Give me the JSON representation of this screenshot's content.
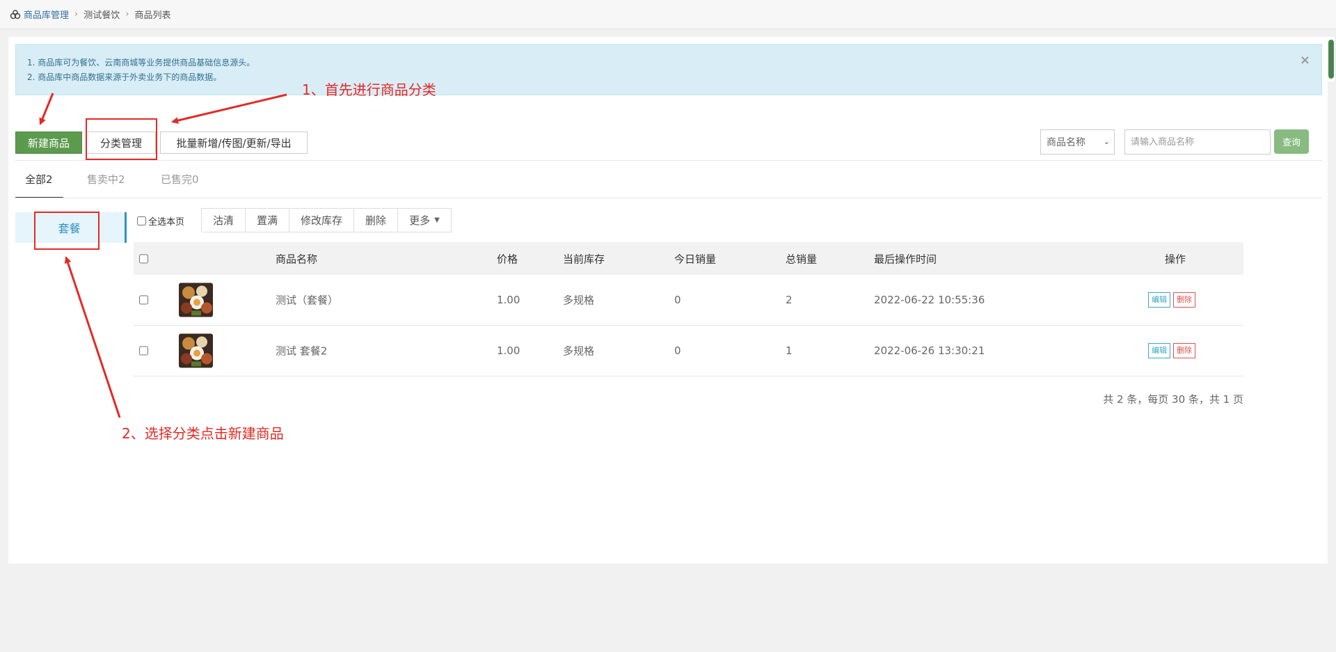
{
  "breadcrumb": {
    "items": [
      "商品库管理",
      "测试餐饮",
      "商品列表"
    ],
    "separator": "›"
  },
  "alert": {
    "lines": [
      "1. 商品库可为餐饮、云南商城等业务提供商品基础信息源头。",
      "2. 商品库中商品数据来源于外卖业务下的商品数据。"
    ],
    "close": "×"
  },
  "annotations": {
    "step1": "1、首先进行商品分类",
    "step2": "2、选择分类点击新建商品",
    "color": "#e32a24"
  },
  "actions": {
    "new": "新建商品",
    "category": "分类管理",
    "batch": "批量新增/传图/更新/导出"
  },
  "search": {
    "field": "商品名称",
    "placeholder": "请输入商品名称",
    "button": "查询"
  },
  "tabs": [
    {
      "label": "全部2",
      "active": true
    },
    {
      "label": "售卖中2",
      "active": false
    },
    {
      "label": "已售完0",
      "active": false
    }
  ],
  "categories": [
    "套餐"
  ],
  "toolbar": {
    "select_all": "全选本页",
    "buttons": [
      "沽清",
      "置满",
      "修改库存",
      "删除",
      "更多"
    ]
  },
  "table": {
    "headers": [
      "商品名称",
      "价格",
      "当前库存",
      "今日销量",
      "总销量",
      "最后操作时间",
      "操作"
    ],
    "rows": [
      {
        "name": "测试（套餐）",
        "price": "1.00",
        "stock": "多规格",
        "today": "0",
        "total": "2",
        "time": "2022-06-22 10:55:36",
        "edit": "编辑",
        "delete": "删除"
      },
      {
        "name": "测试 套餐2",
        "price": "1.00",
        "stock": "多规格",
        "today": "0",
        "total": "1",
        "time": "2022-06-26 13:30:21",
        "edit": "编辑",
        "delete": "删除"
      }
    ]
  },
  "pager": "共 2 条，每页 30 条，共 1 页",
  "colors": {
    "primary_green": "#5c9a4e",
    "accent_blue": "#2f93c5",
    "alert_bg": "#d9edf7",
    "annotation_red": "#e32a24"
  }
}
